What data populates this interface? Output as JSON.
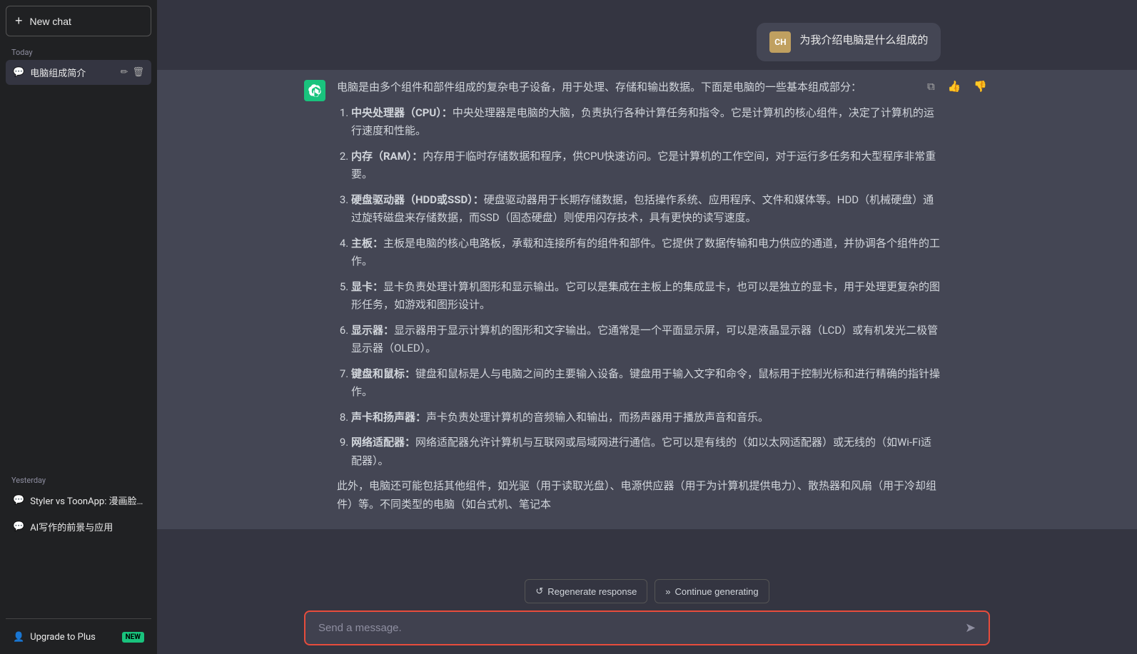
{
  "sidebar": {
    "new_chat_label": "New chat",
    "today_label": "Today",
    "yesterday_label": "Yesterday",
    "today_chats": [
      {
        "id": "1",
        "label": "电脑组成简介",
        "active": true
      }
    ],
    "yesterday_chats": [
      {
        "id": "2",
        "label": "Styler vs ToonApp: 漫画脸优差",
        "active": false
      },
      {
        "id": "3",
        "label": "AI写作的前景与应用",
        "active": false
      }
    ],
    "upgrade_label": "Upgrade to Plus",
    "new_badge": "NEW"
  },
  "chat": {
    "user_avatar_initials": "CH",
    "user_question": "为我介绍电脑是什么组成的",
    "assistant_intro": "电脑是由多个组件和部件组成的复杂电子设备，用于处理、存储和输出数据。下面是电脑的一些基本组成部分：",
    "components": [
      {
        "number": "1",
        "title": "中央处理器（CPU）",
        "desc": "中央处理器是电脑的大脑，负责执行各种计算任务和指令。它是计算机的核心组件，决定了计算机的运行速度和性能。"
      },
      {
        "number": "2",
        "title": "内存（RAM）",
        "desc": "内存用于临时存储数据和程序，供CPU快速访问。它是计算机的工作空间，对于运行多任务和大型程序非常重要。"
      },
      {
        "number": "3",
        "title": "硬盘驱动器（HDD或SSD）",
        "desc": "硬盘驱动器用于长期存储数据，包括操作系统、应用程序、文件和媒体等。HDD（机械硬盘）通过旋转磁盘来存储数据，而SSD（固态硬盘）则使用闪存技术，具有更快的读写速度。"
      },
      {
        "number": "4",
        "title": "主板",
        "desc": "主板是电脑的核心电路板，承载和连接所有的组件和部件。它提供了数据传输和电力供应的通道，并协调各个组件的工作。"
      },
      {
        "number": "5",
        "title": "显卡",
        "desc": "显卡负责处理计算机图形和显示输出。它可以是集成在主板上的集成显卡，也可以是独立的显卡，用于处理更复杂的图形任务，如游戏和图形设计。"
      },
      {
        "number": "6",
        "title": "显示器",
        "desc": "显示器用于显示计算机的图形和文字输出。它通常是一个平面显示屏，可以是液晶显示器（LCD）或有机发光二极管显示器（OLED）。"
      },
      {
        "number": "7",
        "title": "键盘和鼠标",
        "desc": "键盘和鼠标是人与电脑之间的主要输入设备。键盘用于输入文字和命令，鼠标用于控制光标和进行精确的指针操作。"
      },
      {
        "number": "8",
        "title": "声卡和扬声器",
        "desc": "声卡负责处理计算机的音频输入和输出，而扬声器用于播放声音和音乐。"
      },
      {
        "number": "9",
        "title": "网络适配器",
        "desc": "网络适配器允许计算机与互联网或局域网进行通信。它可以是有线的（如以太网适配器）或无线的（如Wi-Fi适配器）。"
      }
    ],
    "footer_text": "此外，电脑还可能包括其他组件，如光驱（用于读取光盘）、电源供应器（用于为计算机提供电力）、散热器和风扇（用于冷却组件）等。不同类型的电脑（如台式机、笔记本",
    "regenerate_label": "Regenerate response",
    "continue_label": "Continue generating",
    "input_placeholder": "Send a message.",
    "send_icon": "➤"
  },
  "icons": {
    "chat_bubble": "💬",
    "pencil": "✏️",
    "trash": "🗑",
    "user": "👤",
    "copy": "⧉",
    "thumbup": "👍",
    "thumbdown": "👎",
    "regenerate": "↺",
    "continue_arrow": "»"
  }
}
